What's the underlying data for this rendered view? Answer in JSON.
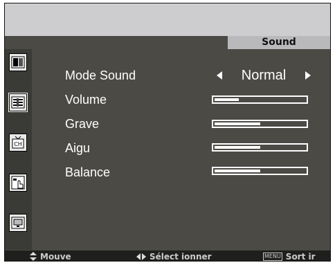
{
  "header": {
    "section_title": "Sound"
  },
  "sidebar": {
    "icons": [
      {
        "name": "picture-icon"
      },
      {
        "name": "sound-icon",
        "active": true
      },
      {
        "name": "channel-icon",
        "label": "CH"
      },
      {
        "name": "setup-hand-icon"
      },
      {
        "name": "screen-icon"
      }
    ]
  },
  "menu": {
    "items": [
      {
        "label": "Mode Sound",
        "type": "select",
        "value": "Normal"
      },
      {
        "label": "Volume",
        "type": "slider",
        "level_percent": 27
      },
      {
        "label": "Grave",
        "type": "slider",
        "level_percent": 50
      },
      {
        "label": "Aigu",
        "type": "slider",
        "level_percent": 50
      },
      {
        "label": "Balance",
        "type": "slider",
        "level_percent": 50
      }
    ]
  },
  "footer": {
    "move_label": "Mouve",
    "select_label": "Sélect ionner",
    "menu_key": "MENU",
    "exit_label": "Sort ir"
  }
}
